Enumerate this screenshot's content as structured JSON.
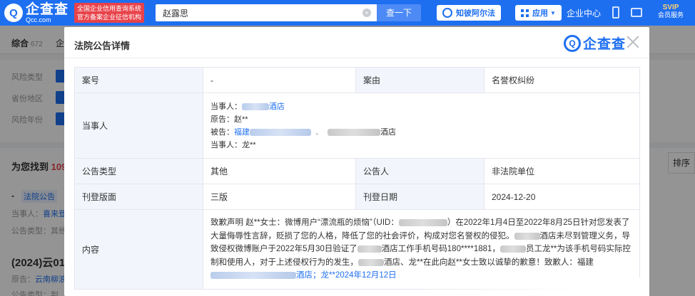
{
  "header": {
    "logo_main": "企查查",
    "logo_sub": "Qcc.com",
    "badge_line1": "全国企业信用查询系统",
    "badge_line2": "官方备案企业征信机构",
    "search_value": "赵露思",
    "search_button": "查一下",
    "law_button": "知彼阿尔法",
    "app_button": "应用",
    "center_link": "企业中心",
    "svip_top": "SVIP",
    "svip_bottom": "会员服务",
    "accent_color": "#1e6ff0"
  },
  "background_page": {
    "tabs": [
      {
        "label": "综合",
        "count": "672"
      },
      {
        "label": "企"
      }
    ],
    "filters": [
      "风险类型",
      "省份地区",
      "风险年份"
    ],
    "found_prefix": "为您找到",
    "found_count": "109",
    "sort_button": "排序",
    "result_tag": "法院公告",
    "result_line1_label": "当事人：",
    "result_line1_value": "喜来登",
    "result_line2": "公告类型：其他",
    "case_title": "(2024)云01",
    "case_line_label": "原告：",
    "case_line_value": "云南柳浪",
    "case_line3": "公告类型：判"
  },
  "modal": {
    "title": "法院公告详情",
    "logo_text": "企查查",
    "rows": {
      "case_no_label": "案号",
      "case_no_value": "-",
      "cause_label": "案由",
      "cause_value": "名誉权纠纷",
      "party_label": "当事人",
      "party_line1_label": "当事人：",
      "party_line1_suffix": "酒店",
      "party_line2": "原告：赵**",
      "party_line3_label": "被告：",
      "party_line3_prefix": "福建",
      "party_line3_suffix": "酒店",
      "party_line4": "当事人：龙**",
      "type_label": "公告类型",
      "type_value": "其他",
      "announcer_label": "公告人",
      "announcer_value": "非法院单位",
      "layout_label": "刊登版面",
      "layout_value": "三版",
      "date_label": "刊登日期",
      "date_value": "2024-12-20",
      "content_label": "内容",
      "content_part1": "致歉声明 赵**女士：微博用户“漂流瓶的烦恼”（UID：",
      "content_part2": "）在2022年1月4日至2022年8月25日针对您发表了大量侮辱性言辞，贬损了您的人格，降低了您的社会评价，构成对您名誉权的侵犯。",
      "content_part3": "酒店未尽到管理义务，导致侵权微博账户于2022年5月30日验证了",
      "content_part4": "酒店工作手机号码180****1881，",
      "content_part5": "员工龙**为该手机号码实际控制和使用人，对于上述侵权行为的发生，",
      "content_part6": "酒店、龙**在此向赵**女士致以诚挚的歉意！致歉人：福建",
      "content_part7": "酒店；龙**2024年12月12日"
    }
  }
}
